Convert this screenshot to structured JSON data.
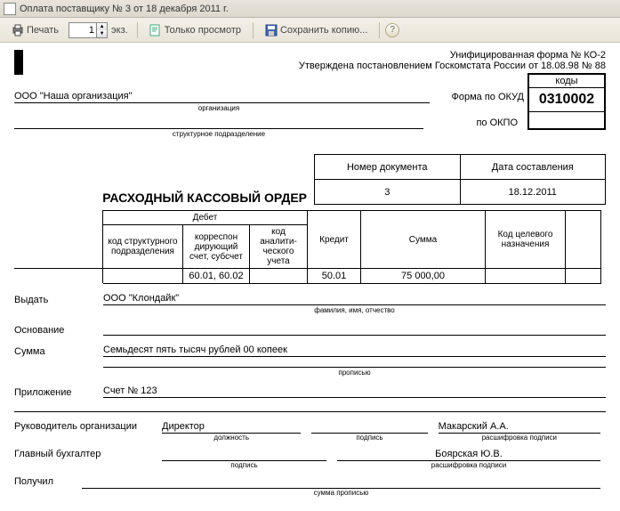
{
  "window": {
    "title": "Оплата поставщику № 3 от 18 декабря 2011 г."
  },
  "toolbar": {
    "print": "Печать",
    "copies": "1",
    "copies_lbl": "экз.",
    "preview": "Только просмотр",
    "save": "Сохранить копию..."
  },
  "header": {
    "form": "Унифицированная форма № КО-2",
    "approved": "Утверждена постановлением Госкомстата России от 18.08.98 № 88",
    "codes_hdr": "коды",
    "okud_lbl": "Форма по ОКУД",
    "okud": "0310002",
    "okpo_lbl": "по ОКПО"
  },
  "org": {
    "name": "ООО \"Наша организация\"",
    "lbl": "организация",
    "sub_lbl": "структурное подразделение"
  },
  "docnum": {
    "num_hdr": "Номер документа",
    "date_hdr": "Дата составления",
    "num": "3",
    "date": "18.12.2011",
    "title": "РАСХОДНЫЙ КАССОВЫЙ ОРДЕР"
  },
  "table": {
    "debet": "Дебет",
    "struct": "код структурного подразделения",
    "korr": "корреспон дирующий счет, субсчет",
    "analyt": "код аналити- ческого учета",
    "kredit": "Кредит",
    "sum": "Сумма",
    "target": "Код целевого назначения",
    "row": {
      "struct": "",
      "korr": "60.01, 60.02",
      "analyt": "",
      "kredit": "50.01",
      "sum": "75 000,00",
      "target": "",
      "empty": ""
    }
  },
  "fields": {
    "issue_lbl": "Выдать",
    "issue_val": "ООО \"Клондайк\"",
    "issue_under": "фамилия, имя, отчество",
    "reason_lbl": "Основание",
    "reason_val": "",
    "sum_lbl": "Сумма",
    "sum_val": "Семьдесят пять тысяч рублей 00 копеек",
    "sum_under": "прописью",
    "attach_lbl": "Приложение",
    "attach_val": "Счет № 123"
  },
  "sign": {
    "head_lbl": "Руководитель организации",
    "head_pos": "Директор",
    "head_name": "Макарский А.А.",
    "pos_under": "должность",
    "sig_under": "подпись",
    "name_under": "расшифровка подписи",
    "acc_lbl": "Главный бухгалтер",
    "acc_name": "Боярская Ю.В.",
    "recv_lbl": "Получил",
    "recv_under": "сумма прописью"
  }
}
